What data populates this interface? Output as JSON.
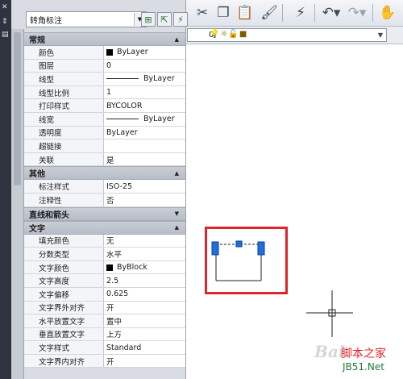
{
  "palette": {
    "object_type": "转角标注",
    "sections": [
      {
        "title": "常规",
        "expanded": true,
        "rows": [
          {
            "name": "颜色",
            "value": "ByLayer",
            "swatch": true
          },
          {
            "name": "图层",
            "value": "0"
          },
          {
            "name": "线型",
            "value": "ByLayer",
            "line_sample": true
          },
          {
            "name": "线型比例",
            "value": "1"
          },
          {
            "name": "打印样式",
            "value": "BYCOLOR"
          },
          {
            "name": "线宽",
            "value": "ByLayer",
            "line_sample": true
          },
          {
            "name": "透明度",
            "value": "ByLayer"
          },
          {
            "name": "超链接",
            "value": ""
          },
          {
            "name": "关联",
            "value": "是"
          }
        ]
      },
      {
        "title": "其他",
        "expanded": true,
        "rows": [
          {
            "name": "标注样式",
            "value": "ISO-25"
          },
          {
            "name": "注释性",
            "value": "否"
          }
        ]
      },
      {
        "title": "直线和箭头",
        "expanded": false,
        "rows": []
      },
      {
        "title": "文字",
        "expanded": true,
        "rows": [
          {
            "name": "填充颜色",
            "value": "无"
          },
          {
            "name": "分数类型",
            "value": "水平"
          },
          {
            "name": "文字颜色",
            "value": "ByBlock",
            "swatch": true
          },
          {
            "name": "文字高度",
            "value": "2.5"
          },
          {
            "name": "文字偏移",
            "value": "0.625"
          },
          {
            "name": "文字界外对齐",
            "value": "开"
          },
          {
            "name": "水平放置文字",
            "value": "置中"
          },
          {
            "name": "垂直放置文字",
            "value": "上方"
          },
          {
            "name": "文字样式",
            "value": "Standard"
          },
          {
            "name": "文字界内对齐",
            "value": "开"
          }
        ]
      }
    ]
  },
  "layer_bar": {
    "current_layer": "0"
  },
  "watermark": {
    "logo": "Bai",
    "site_name": "脚本之家",
    "site_url": "JB51.Net"
  },
  "colors": {
    "highlight": "#e0242a",
    "grip": "#1f6fe0"
  },
  "icons": {
    "toolbar": [
      "cut-icon",
      "copy-icon",
      "paste-icon",
      "match-properties-icon",
      "publish-icon",
      "undo-icon",
      "redo-icon",
      "pan-hand-icon"
    ],
    "palette_tools": [
      "toggle-pickadd-icon",
      "select-objects-icon",
      "quick-select-icon"
    ]
  }
}
